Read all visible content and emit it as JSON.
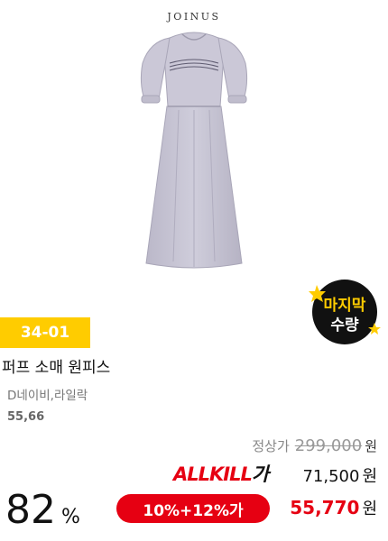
{
  "brand": "JOINUS",
  "badge": {
    "code": "34-01",
    "last_stock_line1": "마지막",
    "last_stock_line2": "수량"
  },
  "product": {
    "name": "퍼프 소매 원피스",
    "colors": "D네이비,라일락",
    "sizes": "55,66"
  },
  "pricing": {
    "original_label": "정상가",
    "original_price": "299,000",
    "currency": "원",
    "allkill_logo_red": "ALLKILL",
    "allkill_logo_dark": "가",
    "allkill_price": "71,500",
    "coupon": "10%+12%가",
    "final_price": "55,770",
    "discount_rate": "82",
    "percent_sign": "%"
  },
  "colors": {
    "badge_yellow": "#ffcc00",
    "accent_red": "#e60012",
    "dress": "#c7c4d3"
  },
  "icons": {
    "product": "dress-image",
    "last_stock": "starburst-badge-icon"
  }
}
